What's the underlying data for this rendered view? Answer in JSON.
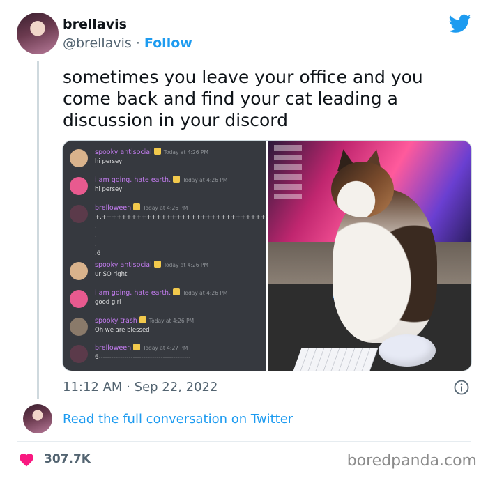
{
  "author": {
    "display_name": "brellavis",
    "handle": "@brellavis",
    "separator": "·",
    "follow_label": "Follow"
  },
  "tweet": {
    "text_lines": [
      "sometimes you leave your office and you",
      "come back and find your cat leading a",
      "discussion in your discord"
    ],
    "time": "11:12 AM",
    "date_separator": "·",
    "date": "Sep 22, 2022"
  },
  "discord_messages": [
    {
      "user": "spooky antisocial",
      "time": "Today at 4:26 PM",
      "body": "hi persey",
      "avatar_color": "#d9b38c"
    },
    {
      "user": "i am going. hate earth.",
      "time": "Today at 4:26 PM",
      "body": "hi persey",
      "avatar_color": "#e85a8f"
    },
    {
      "user": "brelloween",
      "time": "Today at 4:26 PM",
      "body": "+,+++++++++++++++++++++++++++++++++++++\n.\n.\n.\n.6",
      "avatar_color": "#5b3a4a"
    },
    {
      "user": "spooky antisocial",
      "time": "Today at 4:26 PM",
      "body": "ur SO right",
      "avatar_color": "#d9b38c"
    },
    {
      "user": "i am going. hate earth.",
      "time": "Today at 4:26 PM",
      "body": "good girl",
      "avatar_color": "#e85a8f"
    },
    {
      "user": "spooky trash",
      "time": "Today at 4:26 PM",
      "body": "Oh we are blessed",
      "avatar_color": "#8a7a6a"
    },
    {
      "user": "brelloween",
      "time": "Today at 4:27 PM",
      "body": "6-------------------------------------------",
      "avatar_color": "#5b3a4a"
    }
  ],
  "read_link": "Read the full conversation on Twitter",
  "likes": "307.7K",
  "watermark": "boredpanda.com",
  "colors": {
    "accent": "#1d9bf0",
    "heart": "#f91880",
    "discord_bg": "#36393f"
  },
  "icons": {
    "bird": "twitter-bird-icon",
    "info": "info-icon",
    "heart": "heart-icon"
  }
}
